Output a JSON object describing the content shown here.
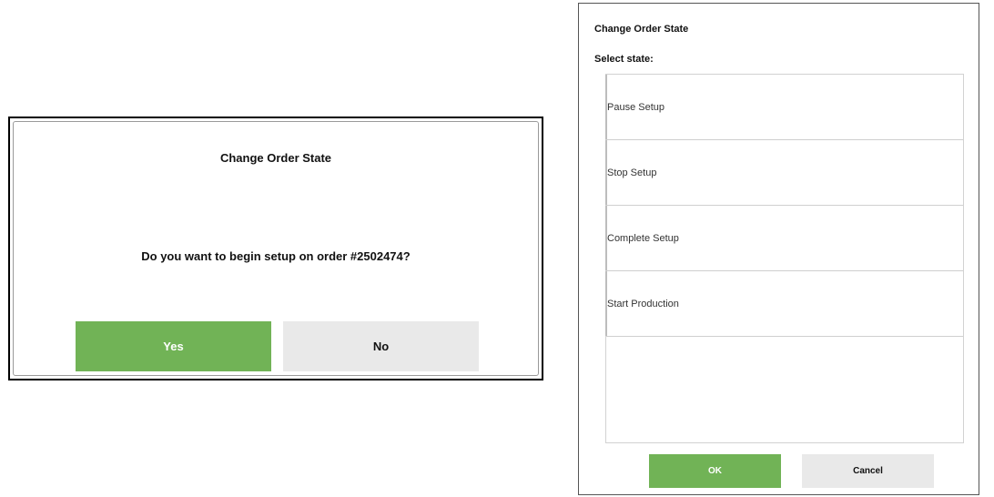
{
  "confirm_dialog": {
    "title": "Change Order State",
    "message": "Do you want to begin setup on order #2502474?",
    "yes_label": "Yes",
    "no_label": "No"
  },
  "state_dialog": {
    "title": "Change Order State",
    "subtitle": "Select state:",
    "states": [
      {
        "label": "Pause Setup"
      },
      {
        "label": "Stop Setup"
      },
      {
        "label": "Complete Setup"
      },
      {
        "label": "Start Production"
      }
    ],
    "ok_label": "OK",
    "cancel_label": "Cancel"
  },
  "colors": {
    "primary_green": "#71b356",
    "secondary_gray": "#e9e9e9",
    "border_dark": "#000000"
  }
}
